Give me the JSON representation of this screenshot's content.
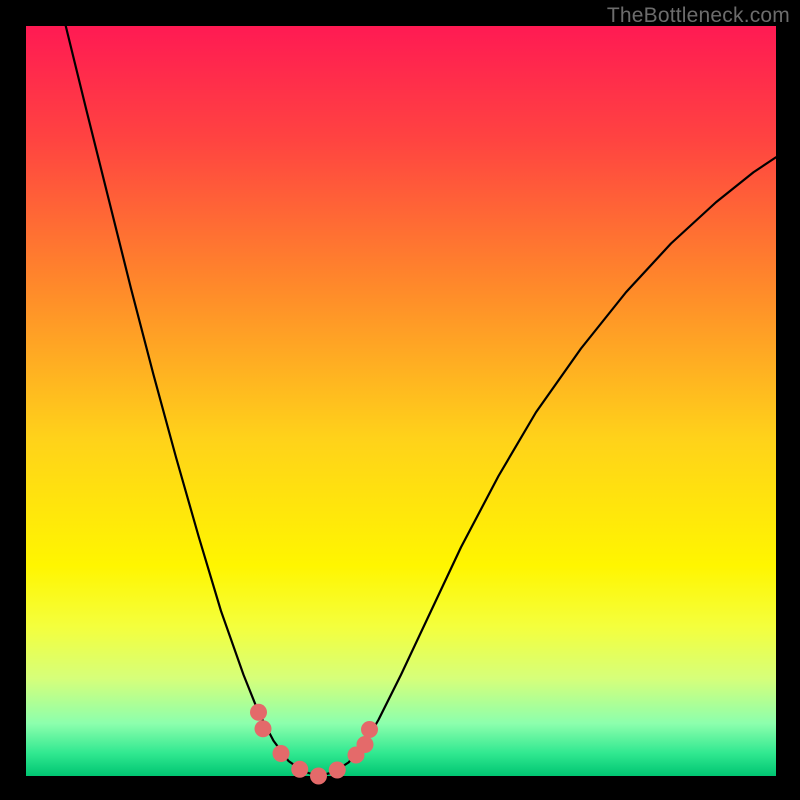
{
  "watermark": "TheBottleneck.com",
  "chart_data": {
    "type": "line",
    "title": "",
    "xlabel": "",
    "ylabel": "",
    "xlim": [
      0,
      100
    ],
    "ylim": [
      0,
      100
    ],
    "gradient_stops": [
      {
        "pct": 0,
        "color": "#ff1a53"
      },
      {
        "pct": 15,
        "color": "#ff4341"
      },
      {
        "pct": 35,
        "color": "#ff8a2a"
      },
      {
        "pct": 55,
        "color": "#ffd21a"
      },
      {
        "pct": 72,
        "color": "#fff600"
      },
      {
        "pct": 80,
        "color": "#f4ff3c"
      },
      {
        "pct": 87,
        "color": "#d6ff7a"
      },
      {
        "pct": 93,
        "color": "#8cffad"
      },
      {
        "pct": 97,
        "color": "#30e890"
      },
      {
        "pct": 100,
        "color": "#00c572"
      }
    ],
    "series": [
      {
        "name": "left-branch",
        "color": "#000000",
        "width": 2.2,
        "points": [
          {
            "x": 5.3,
            "y": 100.0
          },
          {
            "x": 8.0,
            "y": 89.0
          },
          {
            "x": 11.0,
            "y": 77.0
          },
          {
            "x": 14.0,
            "y": 65.0
          },
          {
            "x": 17.0,
            "y": 53.5
          },
          {
            "x": 20.0,
            "y": 42.5
          },
          {
            "x": 23.0,
            "y": 32.0
          },
          {
            "x": 26.0,
            "y": 22.0
          },
          {
            "x": 29.0,
            "y": 13.5
          },
          {
            "x": 31.0,
            "y": 8.5
          },
          {
            "x": 33.0,
            "y": 4.7
          },
          {
            "x": 35.0,
            "y": 2.0
          },
          {
            "x": 37.0,
            "y": 0.6
          },
          {
            "x": 39.0,
            "y": 0.0
          }
        ]
      },
      {
        "name": "right-branch",
        "color": "#000000",
        "width": 2.2,
        "points": [
          {
            "x": 39.0,
            "y": 0.0
          },
          {
            "x": 41.0,
            "y": 0.5
          },
          {
            "x": 43.0,
            "y": 1.8
          },
          {
            "x": 45.0,
            "y": 4.0
          },
          {
            "x": 47.0,
            "y": 7.5
          },
          {
            "x": 50.0,
            "y": 13.5
          },
          {
            "x": 54.0,
            "y": 22.0
          },
          {
            "x": 58.0,
            "y": 30.5
          },
          {
            "x": 63.0,
            "y": 40.0
          },
          {
            "x": 68.0,
            "y": 48.5
          },
          {
            "x": 74.0,
            "y": 57.0
          },
          {
            "x": 80.0,
            "y": 64.5
          },
          {
            "x": 86.0,
            "y": 71.0
          },
          {
            "x": 92.0,
            "y": 76.5
          },
          {
            "x": 97.0,
            "y": 80.5
          },
          {
            "x": 100.0,
            "y": 82.5
          }
        ]
      }
    ],
    "markers": {
      "color": "#e46a6a",
      "radius": 8.5,
      "points": [
        {
          "x": 31.0,
          "y": 8.5
        },
        {
          "x": 31.6,
          "y": 6.3
        },
        {
          "x": 34.0,
          "y": 3.0
        },
        {
          "x": 36.5,
          "y": 0.9
        },
        {
          "x": 39.0,
          "y": 0.0
        },
        {
          "x": 41.5,
          "y": 0.8
        },
        {
          "x": 44.0,
          "y": 2.8
        },
        {
          "x": 45.2,
          "y": 4.2
        },
        {
          "x": 45.8,
          "y": 6.2
        }
      ]
    }
  }
}
